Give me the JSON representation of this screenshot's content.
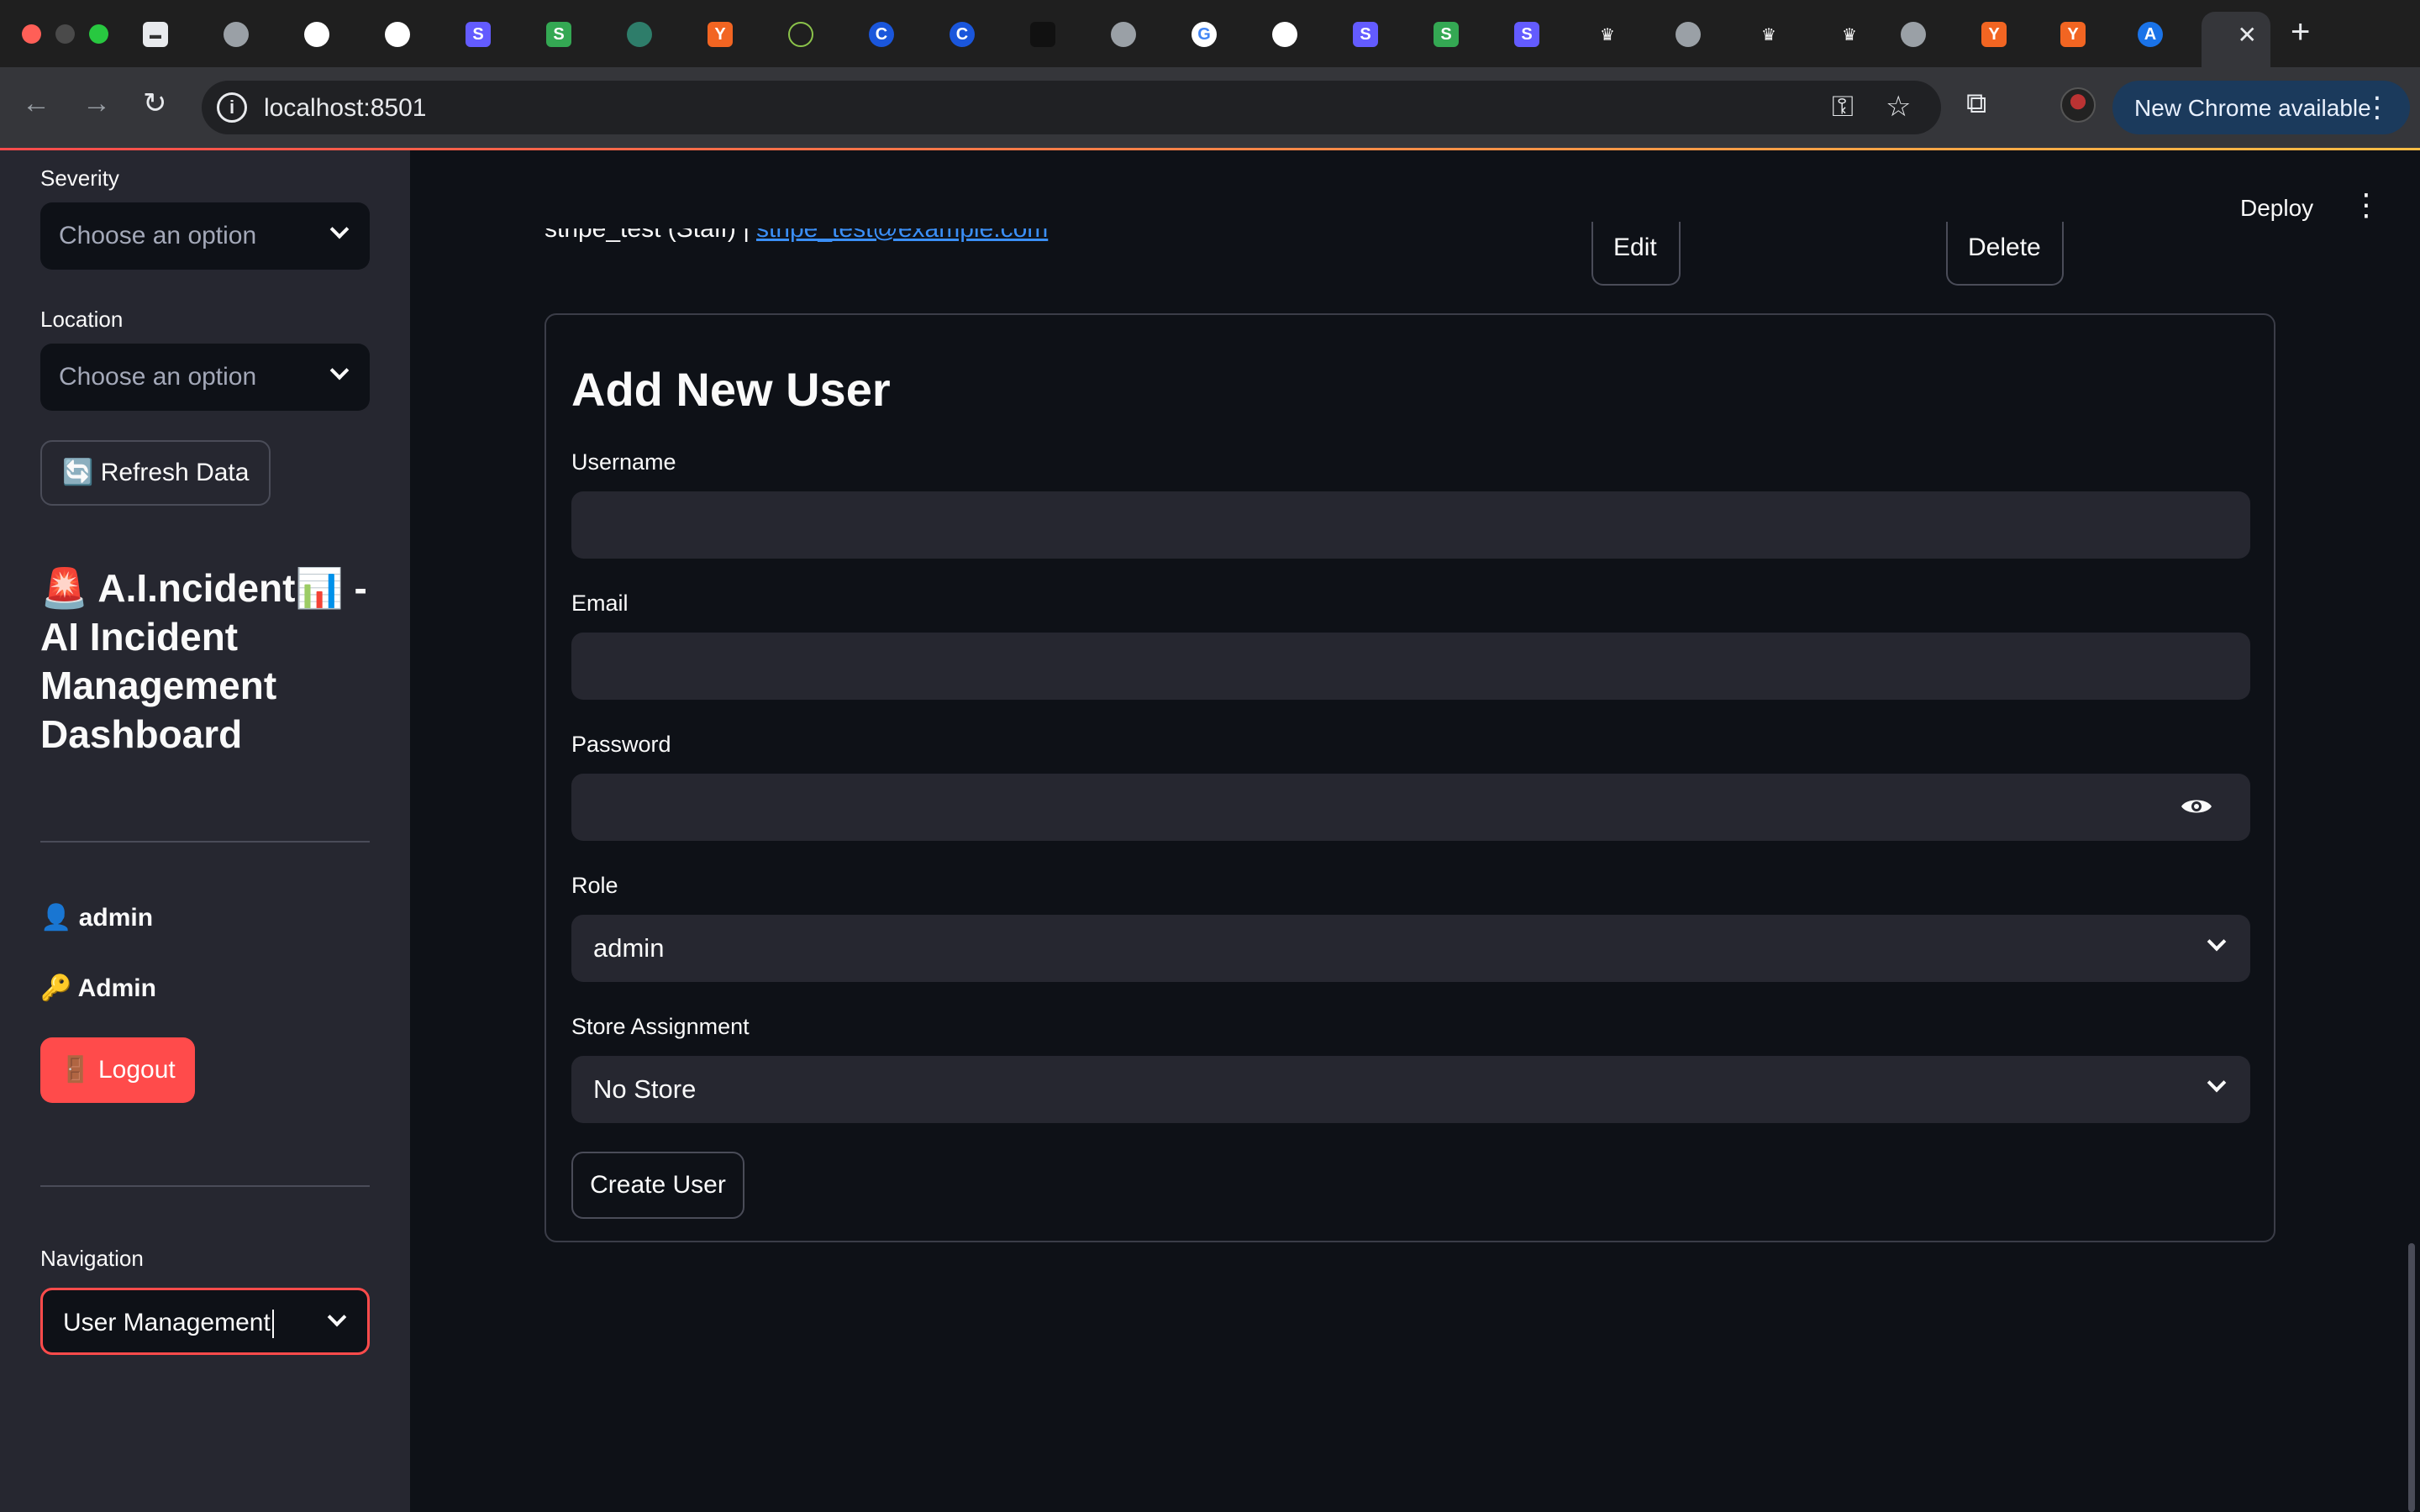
{
  "browser": {
    "url": "localhost:8501",
    "update_label": "New Chrome available"
  },
  "app": {
    "deploy_label": "Deploy"
  },
  "sidebar": {
    "severity_label": "Severity",
    "severity_placeholder": "Choose an option",
    "location_label": "Location",
    "location_placeholder": "Choose an option",
    "refresh_label": "🔄 Refresh Data",
    "title": "🚨 A.I.ncident📊 - AI Incident Management Dashboard",
    "user_name": "👤 admin",
    "user_role": "🔑 Admin",
    "logout_label": "🚪 Logout",
    "navigation_label": "Navigation",
    "navigation_value": "User Management"
  },
  "user_row": {
    "name_text": "stripe_test (Staff) |",
    "email_link": "stripe_test@example.com",
    "edit_label": "Edit",
    "delete_label": "Delete"
  },
  "add_user_form": {
    "title": "Add New User",
    "username_label": "Username",
    "username_value": "",
    "email_label": "Email",
    "email_value": "",
    "password_label": "Password",
    "password_value": "",
    "role_label": "Role",
    "role_value": "admin",
    "store_label": "Store Assignment",
    "store_value": "No Store",
    "submit_label": "Create User"
  }
}
